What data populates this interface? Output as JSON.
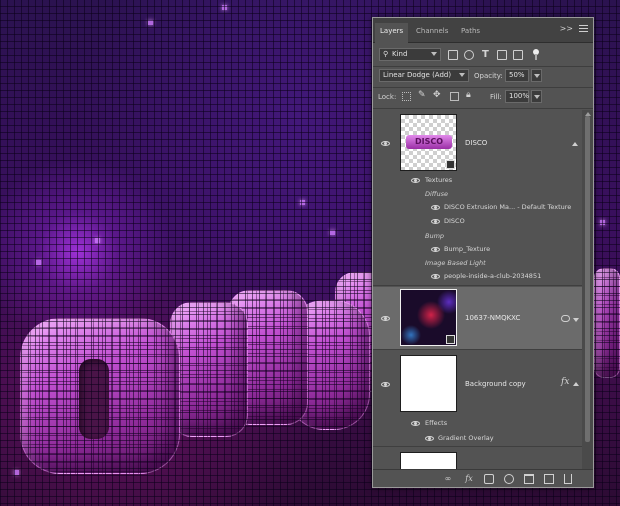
{
  "panel": {
    "tabs": [
      {
        "label": "Layers",
        "active": true
      },
      {
        "label": "Channels",
        "active": false
      },
      {
        "label": "Paths",
        "active": false
      }
    ],
    "menu_arrows": ">>",
    "filter": {
      "kind_label": "Kind",
      "icons": [
        "pixel-filter-icon",
        "adjustment-filter-icon",
        "type-filter-icon",
        "shape-filter-icon",
        "smart-object-filter-icon",
        "filter-toggle-icon"
      ]
    },
    "blend_mode": "Linear Dodge (Add)",
    "opacity_label": "Opacity:",
    "opacity_value": "50%",
    "lock_label": "Lock:",
    "fill_label": "Fill:",
    "fill_value": "100%"
  },
  "layers": [
    {
      "name": "DISCO",
      "thumb_text": "DISCO",
      "textures_label": "Textures",
      "diffuse_label": "Diffuse",
      "diffuse_items": [
        "DISCO Extrusion Ma... - Default Texture",
        "DISCO"
      ],
      "bump_label": "Bump",
      "bump_items": [
        "Bump_Texture"
      ],
      "ibl_label": "Image Based Light",
      "ibl_items": [
        "people-inside-a-club-2034851"
      ]
    },
    {
      "name": "10637-NMQKXC",
      "selected": true
    },
    {
      "name": "Background copy",
      "effects_label": "Effects",
      "effects_items": [
        "Gradient Overlay"
      ]
    }
  ],
  "bottom_icons": [
    "link-icon",
    "fx-icon",
    "mask-icon",
    "adjustment-icon",
    "group-icon",
    "new-layer-icon",
    "trash-icon"
  ],
  "colors": {
    "panel_bg": "#535353",
    "selected_row": "#6b6b6b",
    "disco_pink": "#b23fbf"
  }
}
